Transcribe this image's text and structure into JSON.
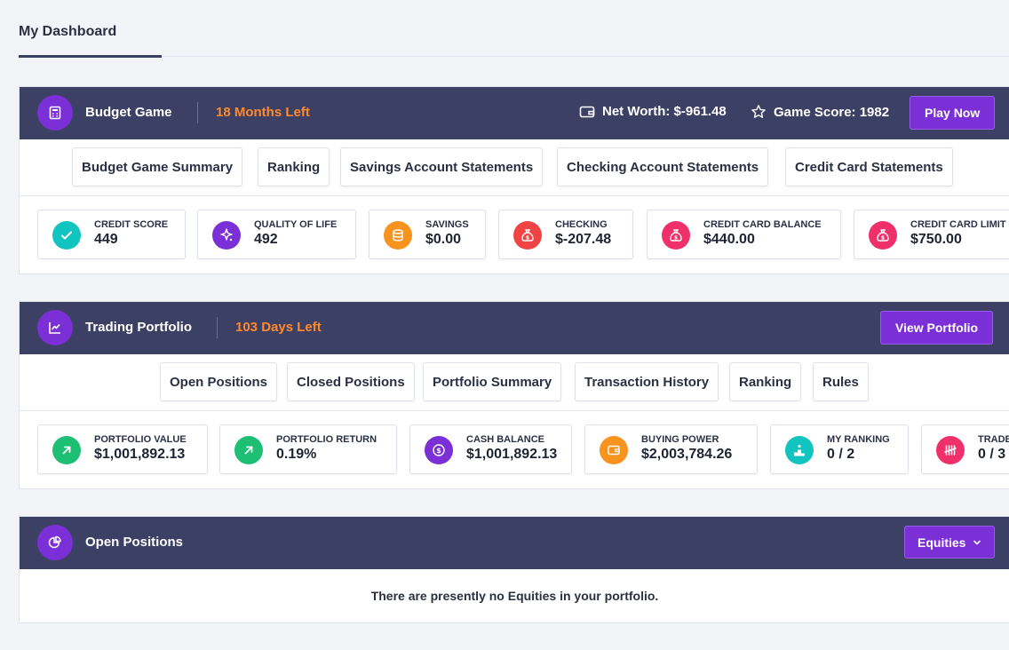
{
  "page": {
    "tab": "My Dashboard"
  },
  "budget": {
    "title": "Budget Game",
    "time_left": "18 Months Left",
    "net_worth": "Net Worth: $-961.48",
    "game_score": "Game Score: 1982",
    "play_button": "Play Now",
    "tabs": [
      "Budget Game Summary",
      "Ranking",
      "Savings Account Statements",
      "Checking Account Statements",
      "Credit Card Statements"
    ],
    "stats": [
      {
        "label": "CREDIT SCORE",
        "value": "449",
        "icon": "check-badge-icon",
        "color": "#11c4bf"
      },
      {
        "label": "QUALITY OF LIFE",
        "value": "492",
        "icon": "sparkle-icon",
        "color": "#7b2fd6"
      },
      {
        "label": "SAVINGS",
        "value": "$0.00",
        "icon": "coins-icon",
        "color": "#f7931e"
      },
      {
        "label": "CHECKING",
        "value": "$-207.48",
        "icon": "money-bag-icon",
        "color": "#f04444"
      },
      {
        "label": "CREDIT CARD BALANCE",
        "value": "$440.00",
        "icon": "money-bag-icon",
        "color": "#f0306b"
      },
      {
        "label": "CREDIT CARD LIMIT",
        "value": "$750.00",
        "icon": "money-bag-icon",
        "color": "#f0306b"
      }
    ]
  },
  "trading": {
    "title": "Trading Portfolio",
    "time_left": "103 Days Left",
    "view_button": "View Portfolio",
    "tabs": [
      "Open Positions",
      "Closed Positions",
      "Portfolio Summary",
      "Transaction History",
      "Ranking",
      "Rules"
    ],
    "stats": [
      {
        "label": "PORTFOLIO VALUE",
        "value": "$1,001,892.13",
        "icon": "arrow-up-right-icon",
        "color": "#1cbf73"
      },
      {
        "label": "PORTFOLIO RETURN",
        "value": "0.19%",
        "icon": "arrow-up-right-icon",
        "color": "#1cbf73"
      },
      {
        "label": "CASH BALANCE",
        "value": "$1,001,892.13",
        "icon": "dollar-coin-icon",
        "color": "#7b2fd6"
      },
      {
        "label": "BUYING POWER",
        "value": "$2,003,784.26",
        "icon": "wallet-icon",
        "color": "#f7931e"
      },
      {
        "label": "MY RANKING",
        "value": "0 / 2",
        "icon": "podium-icon",
        "color": "#11c4bf"
      },
      {
        "label": "TRADES",
        "value": "0 / 3",
        "icon": "tally-icon",
        "color": "#f0306b"
      }
    ]
  },
  "open_positions": {
    "title": "Open Positions",
    "dropdown": "Equities",
    "empty_message": "There are presently no Equities in your portfolio."
  },
  "colors": {
    "header": "#3d4065",
    "accent": "#7b2fd6",
    "time_left": "#ff8a2b"
  }
}
